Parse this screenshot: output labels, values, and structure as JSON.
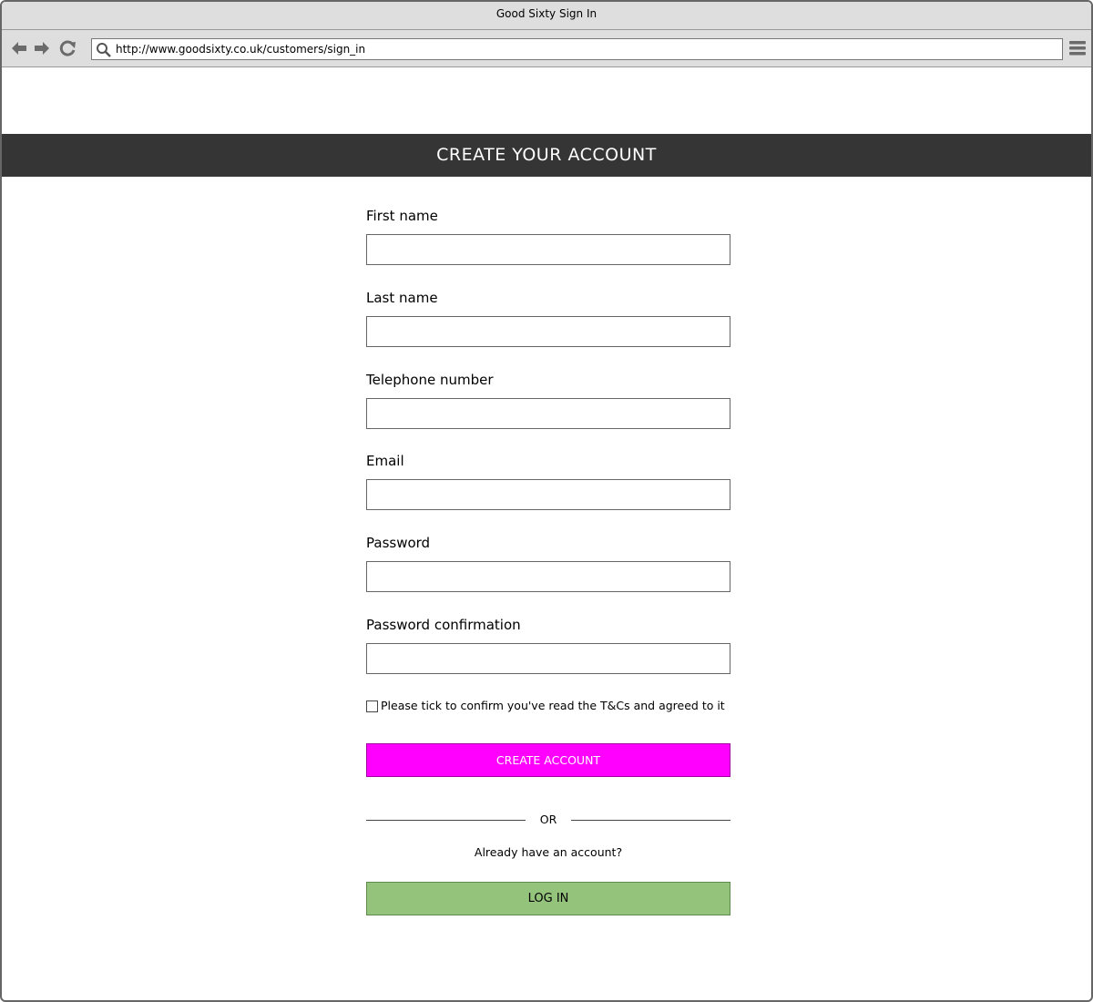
{
  "browser": {
    "window_title": "Good Sixty Sign In",
    "url": "http://www.goodsixty.co.uk/customers/sign_in",
    "icons": [
      "back-arrow-icon",
      "forward-arrow-icon",
      "reload-icon",
      "search-icon",
      "hamburger-menu-icon"
    ]
  },
  "page": {
    "header_title": "CREATE YOUR ACCOUNT"
  },
  "form": {
    "fields": [
      {
        "label": "First name",
        "value": ""
      },
      {
        "label": "Last name",
        "value": ""
      },
      {
        "label": "Telephone number",
        "value": ""
      },
      {
        "label": "Email",
        "value": ""
      },
      {
        "label": "Password",
        "value": ""
      },
      {
        "label": "Password confirmation",
        "value": ""
      }
    ],
    "terms_label": "Please tick to confirm you've read the T&Cs and agreed to it",
    "terms_checked": false,
    "create_button": "CREATE ACCOUNT",
    "or_text": "OR",
    "already_text": "Already have an account?",
    "login_button": "LOG IN"
  },
  "colors": {
    "header_band": "#353535",
    "create_button": "#ff00ff",
    "login_button": "#94c47c",
    "chrome": "#dedede"
  }
}
